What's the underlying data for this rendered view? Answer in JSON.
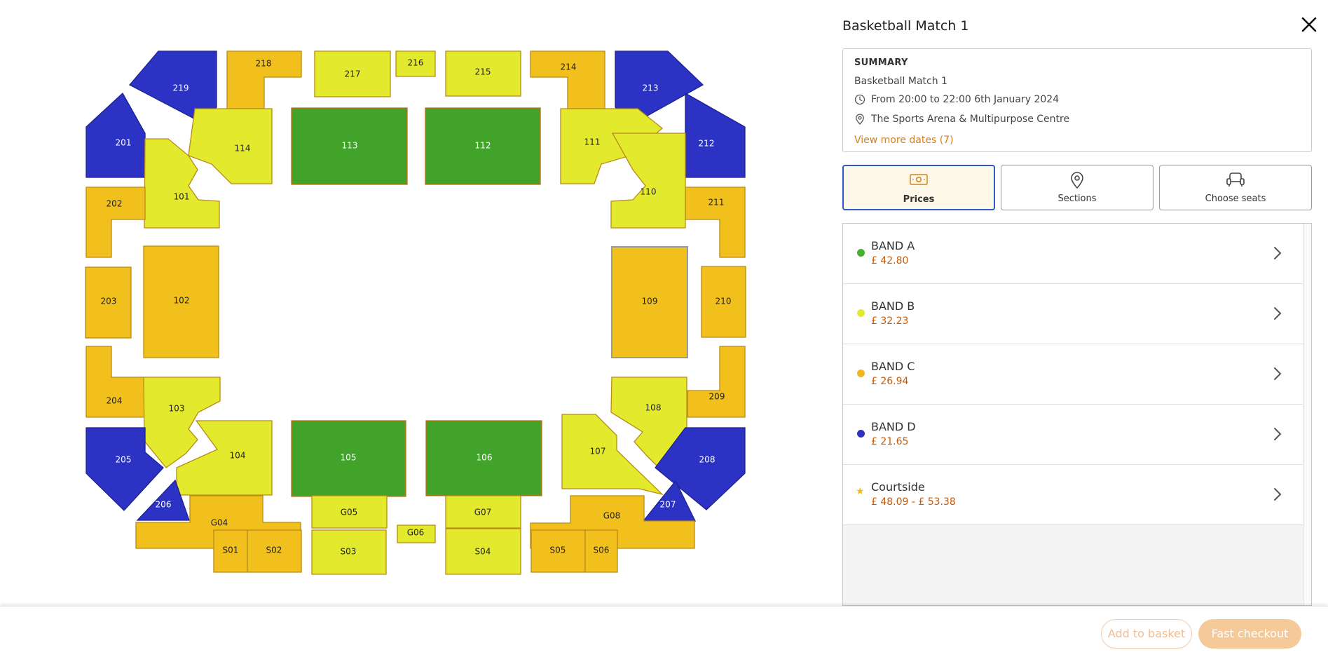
{
  "colors": {
    "band_a": "#42a32a",
    "band_b": "#e3ea2d",
    "band_c": "#f2c01c",
    "band_d": "#2c33c4",
    "accent": "#d3811e",
    "active_tab_border": "#2f59c9"
  },
  "seat_map": {
    "sections": [
      {
        "id": "219",
        "band": "D"
      },
      {
        "id": "218",
        "band": "C"
      },
      {
        "id": "217",
        "band": "B"
      },
      {
        "id": "216",
        "band": "B"
      },
      {
        "id": "215",
        "band": "B"
      },
      {
        "id": "214",
        "band": "C"
      },
      {
        "id": "213",
        "band": "D"
      },
      {
        "id": "201",
        "band": "D"
      },
      {
        "id": "114",
        "band": "B"
      },
      {
        "id": "113",
        "band": "A"
      },
      {
        "id": "112",
        "band": "A"
      },
      {
        "id": "111",
        "band": "B"
      },
      {
        "id": "212",
        "band": "D"
      },
      {
        "id": "101",
        "band": "B"
      },
      {
        "id": "110",
        "band": "B"
      },
      {
        "id": "202",
        "band": "C"
      },
      {
        "id": "211",
        "band": "C"
      },
      {
        "id": "203",
        "band": "C"
      },
      {
        "id": "102",
        "band": "C"
      },
      {
        "id": "109",
        "band": "C"
      },
      {
        "id": "210",
        "band": "C"
      },
      {
        "id": "204",
        "band": "C"
      },
      {
        "id": "103",
        "band": "B"
      },
      {
        "id": "108",
        "band": "B"
      },
      {
        "id": "209",
        "band": "C"
      },
      {
        "id": "205",
        "band": "D"
      },
      {
        "id": "104",
        "band": "B"
      },
      {
        "id": "105",
        "band": "A"
      },
      {
        "id": "106",
        "band": "A"
      },
      {
        "id": "107",
        "band": "B"
      },
      {
        "id": "208",
        "band": "D"
      },
      {
        "id": "206",
        "band": "D"
      },
      {
        "id": "207",
        "band": "D"
      },
      {
        "id": "G04",
        "band": "C"
      },
      {
        "id": "G05",
        "band": "B"
      },
      {
        "id": "G06",
        "band": "B"
      },
      {
        "id": "G07",
        "band": "B"
      },
      {
        "id": "G08",
        "band": "C"
      },
      {
        "id": "S01",
        "band": "C"
      },
      {
        "id": "S02",
        "band": "C"
      },
      {
        "id": "S03",
        "band": "B"
      },
      {
        "id": "S04",
        "band": "B"
      },
      {
        "id": "S05",
        "band": "C"
      },
      {
        "id": "S06",
        "band": "C"
      }
    ]
  },
  "panel": {
    "title": "Basketball Match 1",
    "close_icon": "close-icon",
    "summary": {
      "heading": "SUMMARY",
      "event": "Basketball Match 1",
      "time": "From 20:00 to 22:00 6th January 2024",
      "venue": "The Sports Arena & Multipurpose Centre",
      "more_dates": "View more dates (7)"
    },
    "tabs": [
      {
        "label": "Prices",
        "icon": "ticket-icon",
        "active": true
      },
      {
        "label": "Sections",
        "icon": "map-pin-icon",
        "active": false
      },
      {
        "label": "Choose seats",
        "icon": "seat-icon",
        "active": false
      }
    ],
    "bands": [
      {
        "name": "BAND A",
        "price": "£ 42.80",
        "color": "#42b32a",
        "marker": "dot"
      },
      {
        "name": "BAND B",
        "price": "£ 32.23",
        "color": "#e3ea2d",
        "marker": "dot"
      },
      {
        "name": "BAND C",
        "price": "£ 26.94",
        "color": "#f2b71c",
        "marker": "dot"
      },
      {
        "name": "BAND D",
        "price": "£ 21.65",
        "color": "#2c33c4",
        "marker": "dot"
      },
      {
        "name": "Courtside",
        "price": "£ 48.09 - £ 53.38",
        "color": "#f2b71c",
        "marker": "star"
      }
    ]
  },
  "footer": {
    "add_to_basket": "Add to basket",
    "fast_checkout": "Fast checkout"
  }
}
